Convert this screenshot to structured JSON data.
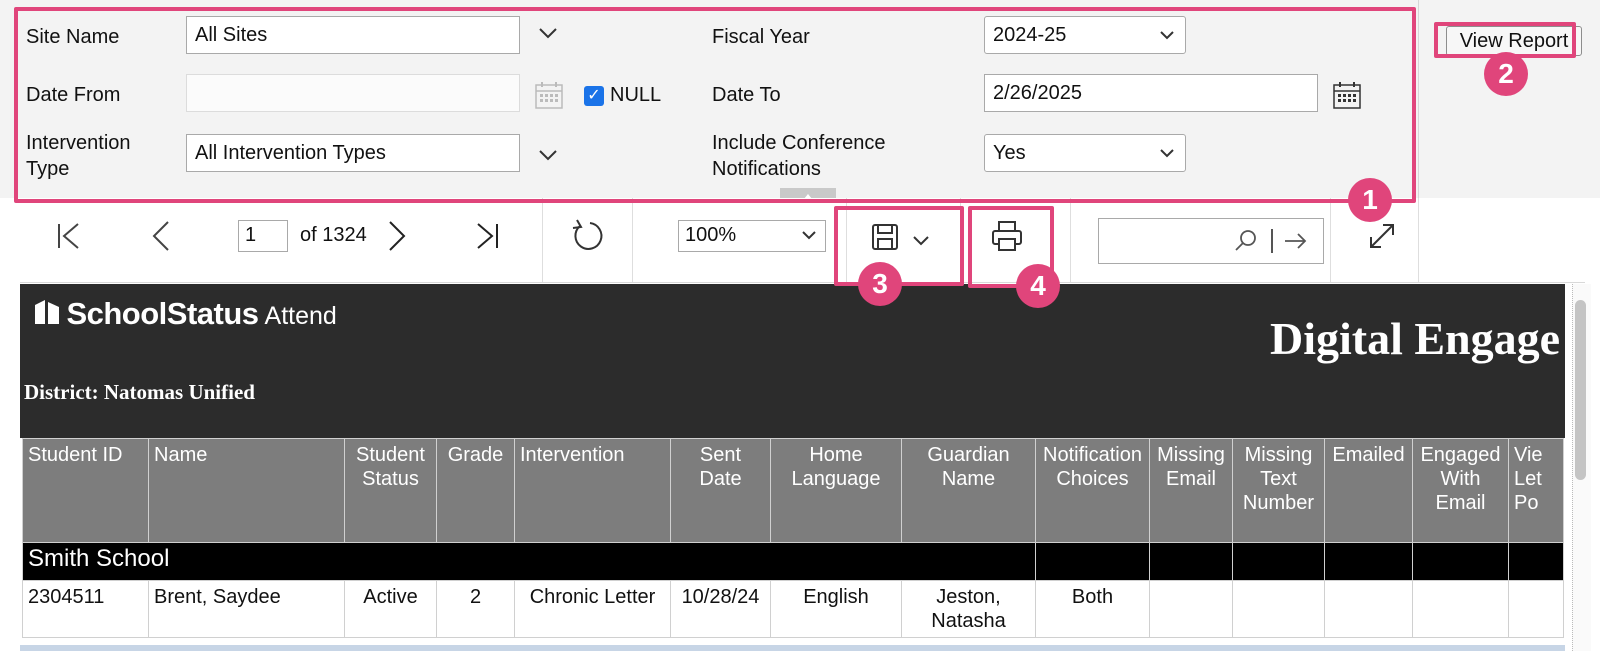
{
  "params": {
    "site_name": {
      "label": "Site Name",
      "value": "All Sites"
    },
    "fiscal_year": {
      "label": "Fiscal Year",
      "value": "2024-25"
    },
    "date_from": {
      "label": "Date From",
      "value": "",
      "null_label": "NULL",
      "null_checked": true
    },
    "date_to": {
      "label": "Date To",
      "value": "2/26/2025"
    },
    "intervention_type": {
      "label_line1": "Intervention",
      "label_line2": "Type",
      "value": "All Intervention Types"
    },
    "include_conference": {
      "label_line1": "Include Conference",
      "label_line2": "Notifications",
      "value": "Yes"
    },
    "view_report_label": "View Report"
  },
  "callouts": {
    "one": "1",
    "two": "2",
    "three": "3",
    "four": "4"
  },
  "toolbar": {
    "current_page": "1",
    "of_pages": "of 1324",
    "zoom": "100%"
  },
  "report": {
    "logo_main": "SchoolStatus",
    "logo_sub": "Attend",
    "title": "Digital Engage",
    "district": "District: Natomas Unified",
    "columns": [
      {
        "line1": "Student ID",
        "line2": "",
        "line3": ""
      },
      {
        "line1": "Name",
        "line2": "",
        "line3": ""
      },
      {
        "line1": "Student",
        "line2": "Status",
        "line3": ""
      },
      {
        "line1": "Grade",
        "line2": "",
        "line3": ""
      },
      {
        "line1": "Intervention",
        "line2": "",
        "line3": ""
      },
      {
        "line1": "Sent",
        "line2": "Date",
        "line3": ""
      },
      {
        "line1": "Home",
        "line2": "Language",
        "line3": ""
      },
      {
        "line1": "Guardian",
        "line2": "Name",
        "line3": ""
      },
      {
        "line1": "Notification",
        "line2": "Choices",
        "line3": ""
      },
      {
        "line1": "Missing",
        "line2": "Email",
        "line3": ""
      },
      {
        "line1": "Missing",
        "line2": "Text",
        "line3": "Number"
      },
      {
        "line1": "Emailed",
        "line2": "",
        "line3": ""
      },
      {
        "line1": "Engaged",
        "line2": "With",
        "line3": "Email"
      },
      {
        "line1": "Vie",
        "line2": "Let",
        "line3": "Po"
      }
    ],
    "group": "Smith School",
    "rows": [
      {
        "student_id": "2304511",
        "name": "Brent, Saydee",
        "status": "Active",
        "grade": "2",
        "intervention": "Chronic Letter",
        "sent_date": "10/28/24",
        "home_language": "English",
        "guardian_line1": "Jeston,",
        "guardian_line2": "Natasha",
        "notification": "Both"
      }
    ]
  }
}
